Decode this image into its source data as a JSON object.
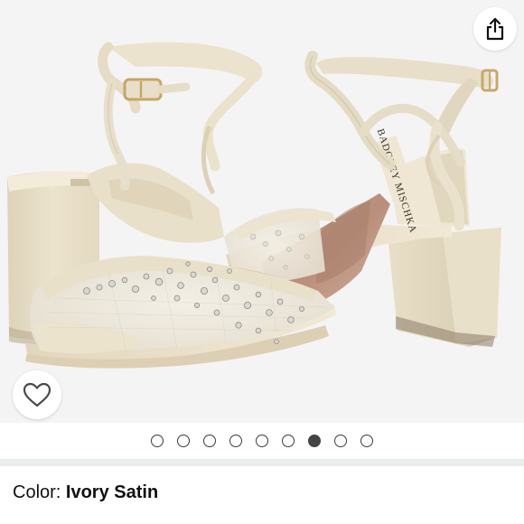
{
  "gallery": {
    "share_icon": "share-icon",
    "wishlist_icon": "heart-outline-icon",
    "dots_count": 9,
    "active_dot_index": 6,
    "insole_brand_text": "BADGLEY MISCHKA"
  },
  "color": {
    "label": "Color: ",
    "value": "Ivory Satin"
  },
  "colors": {
    "background": "#f4f4f4",
    "satin": "#ece3cc",
    "accent_text": "#0f1111",
    "divider": "#eaeded"
  }
}
